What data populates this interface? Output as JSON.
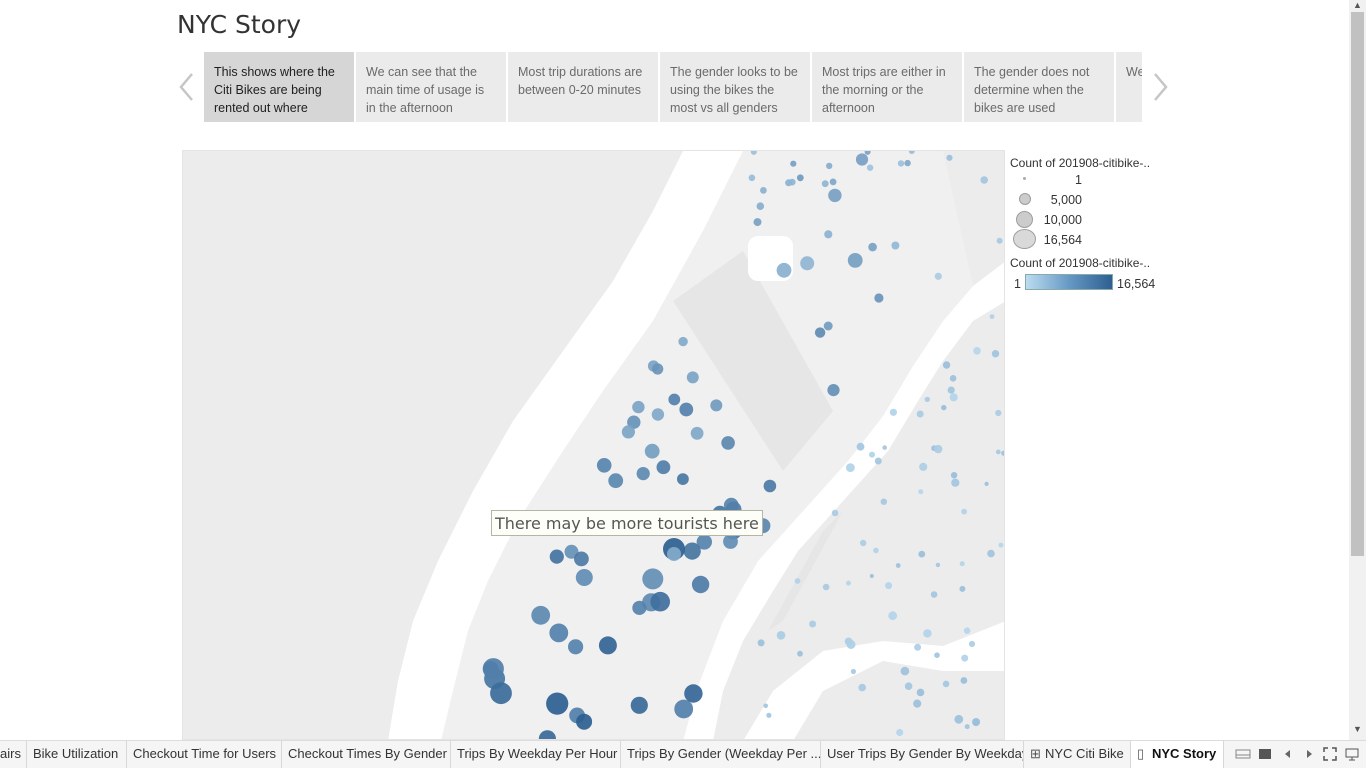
{
  "story": {
    "title": "NYC Story",
    "points": [
      "This shows where the Citi Bikes are being rented out where",
      "We can see that the main time of usage is in the afternoon",
      "Most trip durations are between 0-20 minutes",
      "The gender looks to be using the bikes the most vs all genders",
      "Most trips are either in the morning or the afternoon",
      "The gender does not determine when the bikes are used",
      "We get the"
    ],
    "active_index": 0
  },
  "legend": {
    "size_title": "Count of 201908-citibike-..",
    "size_items": [
      "1",
      "5,000",
      "10,000",
      "16,564"
    ],
    "color_title": "Count of 201908-citibike-..",
    "color_min": "1",
    "color_max": "16,564",
    "color_low": "#bcdcf0",
    "color_high": "#2d5f91"
  },
  "annotation": "There may be more tourists here",
  "icons": {
    "prev": "chevron-left-icon",
    "next": "chevron-right-icon",
    "dashboard_tab": "grid-icon",
    "story_tab": "book-icon"
  },
  "tabs": [
    {
      "label": "airs",
      "icon": ""
    },
    {
      "label": "Bike Utilization",
      "icon": ""
    },
    {
      "label": "Checkout Time for Users",
      "icon": ""
    },
    {
      "label": "Checkout Times By Gender",
      "icon": ""
    },
    {
      "label": "Trips By Weekday Per Hour",
      "icon": ""
    },
    {
      "label": "Trips By Gender (Weekday Per ...",
      "icon": ""
    },
    {
      "label": "User Trips By Gender By Weekday",
      "icon": ""
    },
    {
      "label": "NYC Citi Bike",
      "icon": "⊞"
    },
    {
      "label": "NYC Story",
      "icon": "▯"
    }
  ],
  "active_tab": "NYC Story"
}
